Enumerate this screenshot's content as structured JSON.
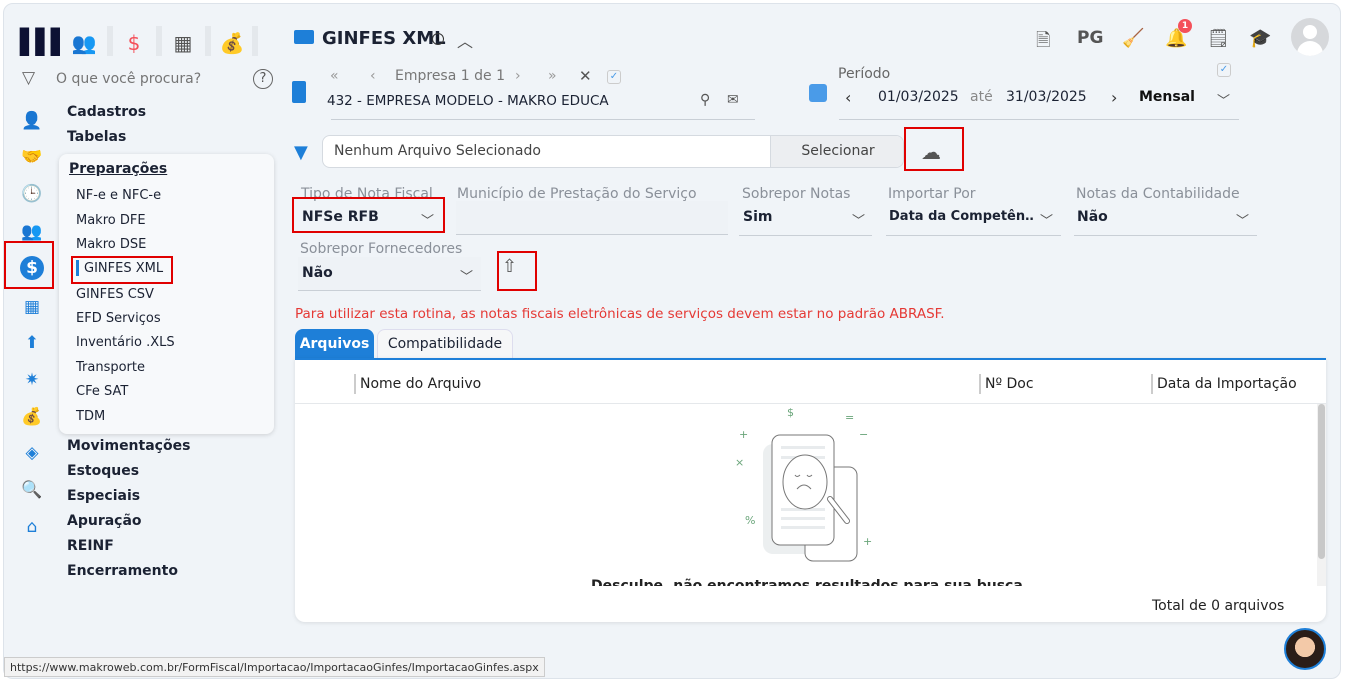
{
  "topbar": {
    "icons": [
      "people-icon",
      "dollar-icon",
      "calculator-icon",
      "money-bag-icon"
    ]
  },
  "search": {
    "placeholder": "O que você procura?"
  },
  "sidebar": {
    "menu": [
      "Cadastros",
      "Tabelas",
      "Movimentações",
      "Estoques",
      "Especiais",
      "Apuração",
      "REINF",
      "Encerramento"
    ],
    "submenu_title": "Preparações",
    "submenu": [
      "NF-e e NFC-e",
      "Makro DFE",
      "Makro DSE",
      "GINFES XML",
      "GINFES CSV",
      "EFD Serviços",
      "Inventário .XLS",
      "Transporte",
      "CFe SAT",
      "TDM"
    ],
    "active_submenu": "GINFES XML"
  },
  "header": {
    "title": "GINFES XML",
    "right_icons": [
      "document-icon",
      "PG",
      "broom-icon",
      "bell-icon",
      "search-document-icon",
      "graduation-cap-icon",
      "avatar"
    ],
    "notification_count": "1",
    "pg_label": "PG"
  },
  "empresa": {
    "nav_label": "Empresa 1 de 1",
    "value": "432 - EMPRESA MODELO - MAKRO EDUCA"
  },
  "periodo": {
    "label": "Período",
    "start": "01/03/2025",
    "ate": "até",
    "end": "31/03/2025",
    "mode": "Mensal"
  },
  "file": {
    "value": "Nenhum Arquivo Selecionado",
    "button": "Selecionar"
  },
  "fields": {
    "tipo": {
      "label": "Tipo de Nota Fiscal",
      "value": "NFSe RFB"
    },
    "municipio": {
      "label": "Município de Prestação do Serviço",
      "value": ""
    },
    "sobrepor_notas": {
      "label": "Sobrepor Notas",
      "value": "Sim"
    },
    "importar_por": {
      "label": "Importar Por",
      "value": "Data da Competên…"
    },
    "notas_contab": {
      "label": "Notas da Contabilidade",
      "value": "Não"
    },
    "sobrepor_forn": {
      "label": "Sobrepor Fornecedores",
      "value": "Não"
    }
  },
  "warning": "Para utilizar esta rotina, as notas fiscais eletrônicas de serviços devem estar no padrão ABRASF.",
  "tabs": [
    "Arquivos",
    "Compatibilidade"
  ],
  "table": {
    "columns": [
      "Nome do Arquivo",
      "Nº Doc",
      "Data da Importação"
    ],
    "rows": [],
    "empty_message": "Desculpe, não encontramos resultados para sua busca",
    "total": "Total de 0 arquivos"
  },
  "statusbar": "https://www.makroweb.com.br/FormFiscal/Importacao/ImportacaoGinfes/ImportacaoGinfes.aspx",
  "colors": {
    "accent": "#1e7fd8",
    "warning": "#e53935",
    "highlight": "#e00000",
    "top_icon": "#f4505a"
  }
}
